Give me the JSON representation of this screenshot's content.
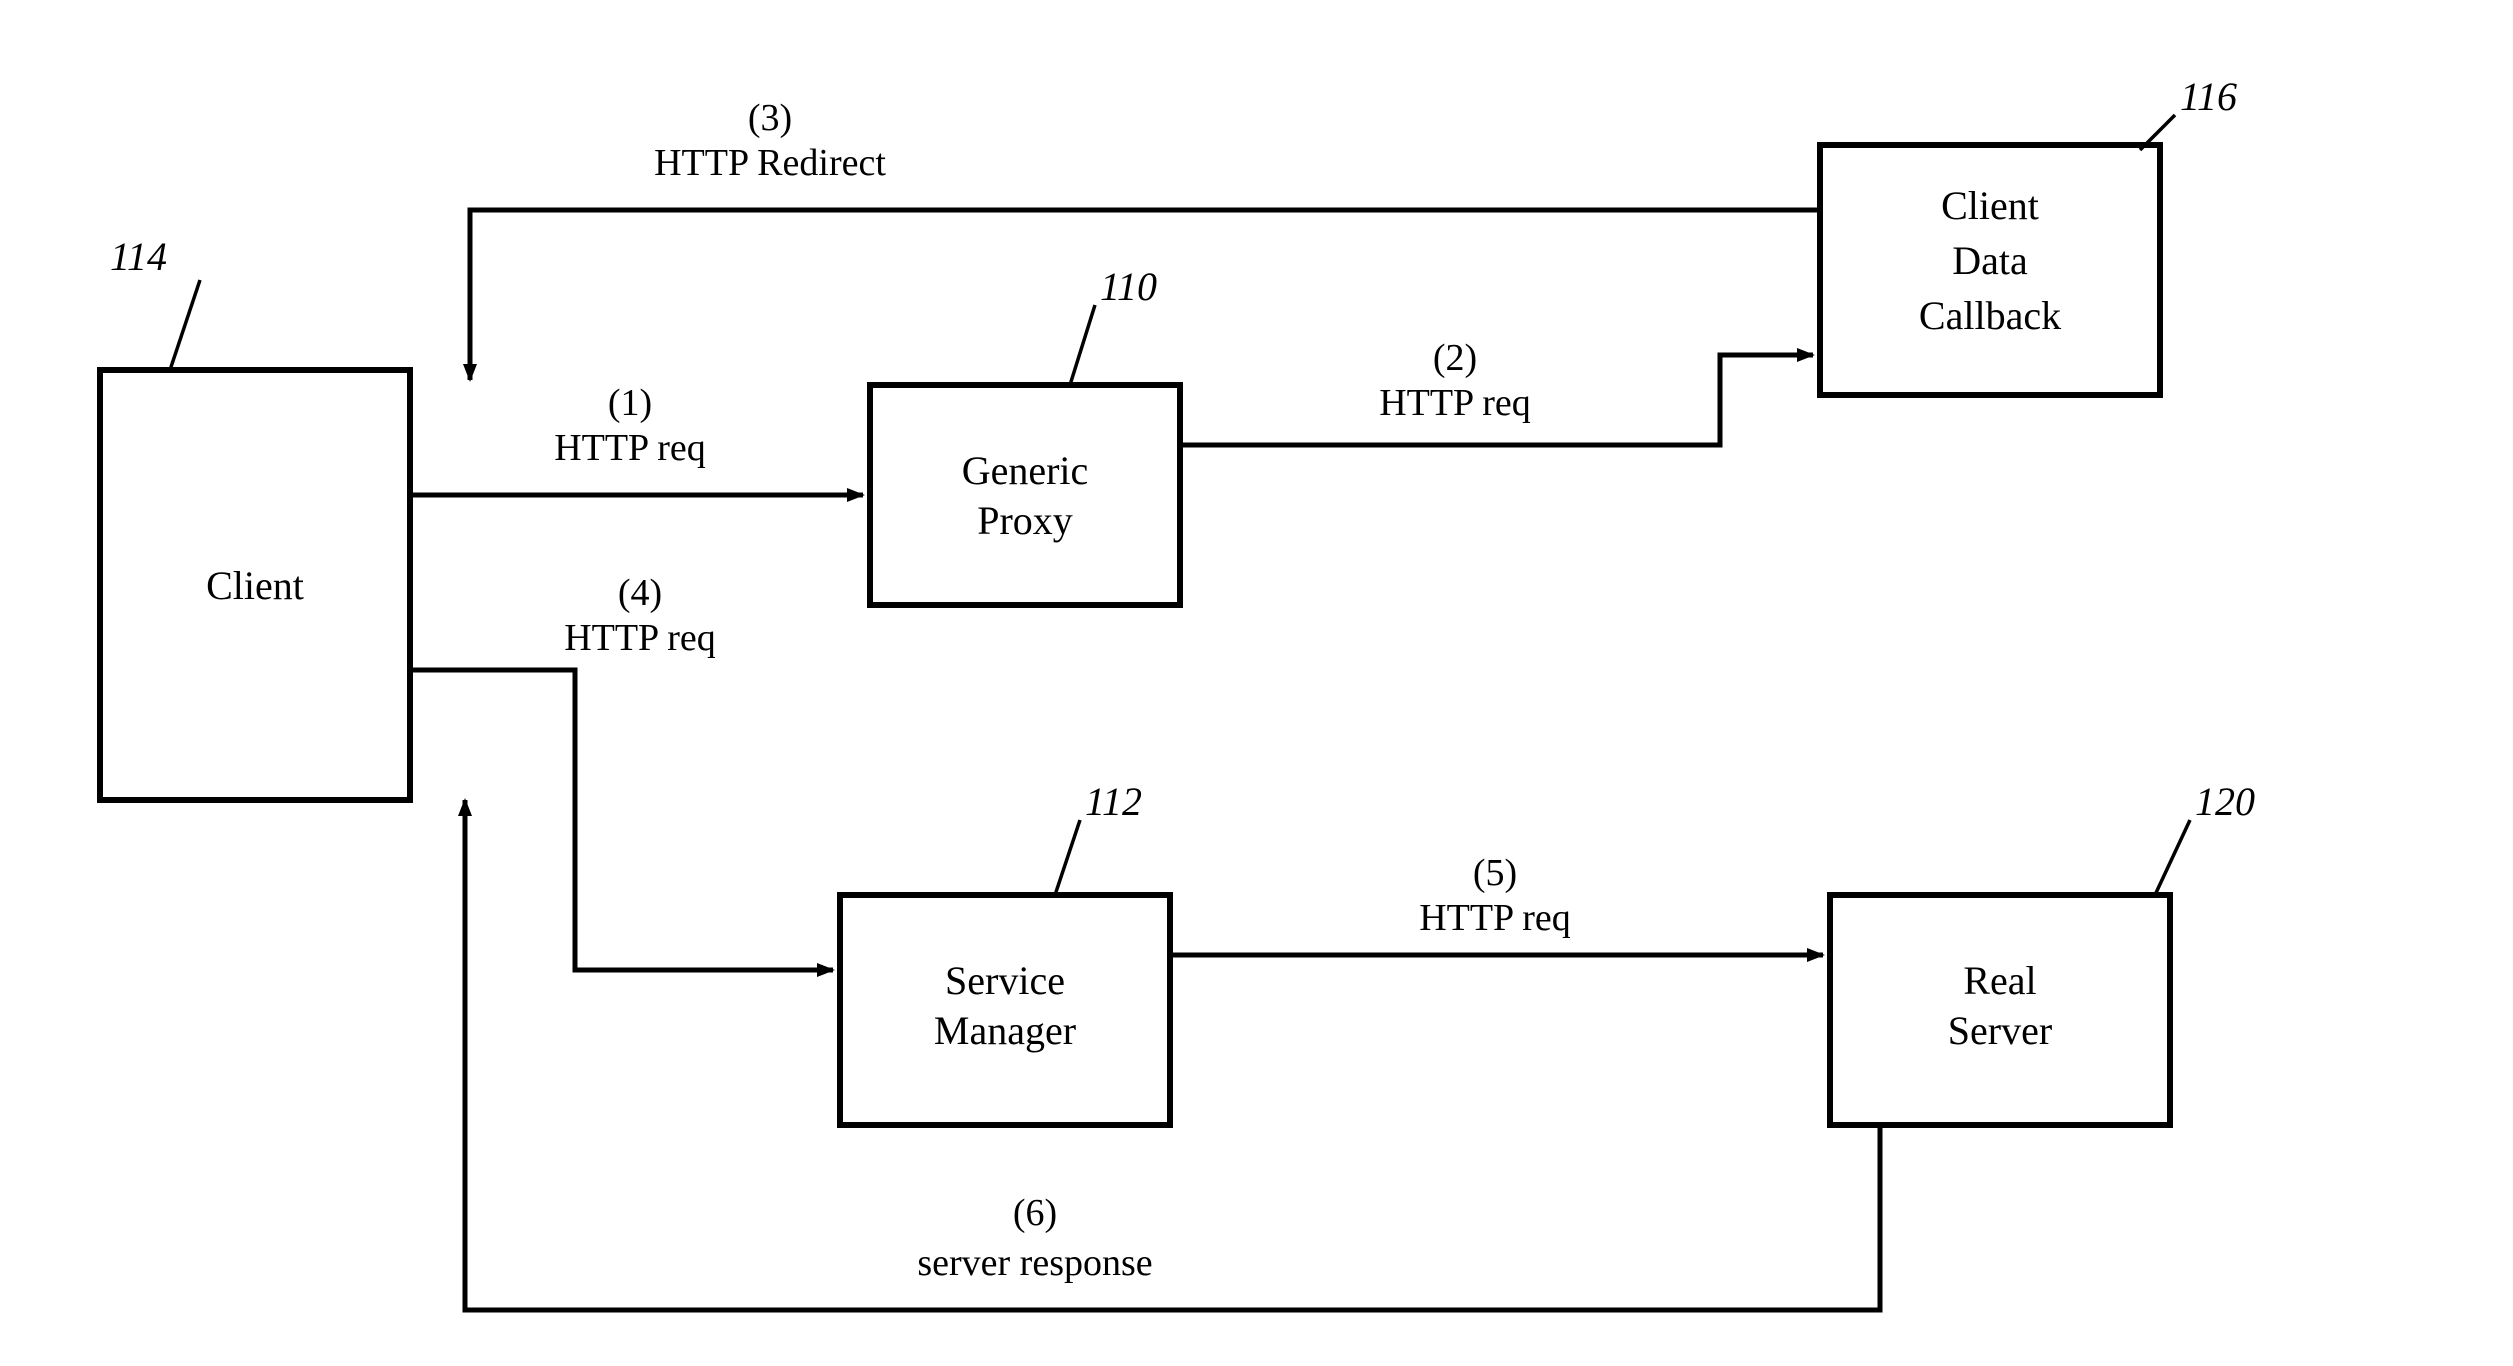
{
  "nodes": {
    "client": {
      "label": "Client",
      "ref": "114"
    },
    "generic_proxy": {
      "label_line1": "Generic",
      "label_line2": "Proxy",
      "ref": "110"
    },
    "client_data_callback": {
      "label_line1": "Client",
      "label_line2": "Data",
      "label_line3": "Callback",
      "ref": "116"
    },
    "service_manager": {
      "label_line1": "Service",
      "label_line2": "Manager",
      "ref": "112"
    },
    "real_server": {
      "label_line1": "Real",
      "label_line2": "Server",
      "ref": "120"
    }
  },
  "edges": {
    "e1": {
      "step": "(1)",
      "label": "HTTP req"
    },
    "e2": {
      "step": "(2)",
      "label": "HTTP req"
    },
    "e3": {
      "step": "(3)",
      "label": "HTTP Redirect"
    },
    "e4": {
      "step": "(4)",
      "label": "HTTP req"
    },
    "e5": {
      "step": "(5)",
      "label": "HTTP req"
    },
    "e6": {
      "step": "(6)",
      "label": "server response"
    }
  }
}
